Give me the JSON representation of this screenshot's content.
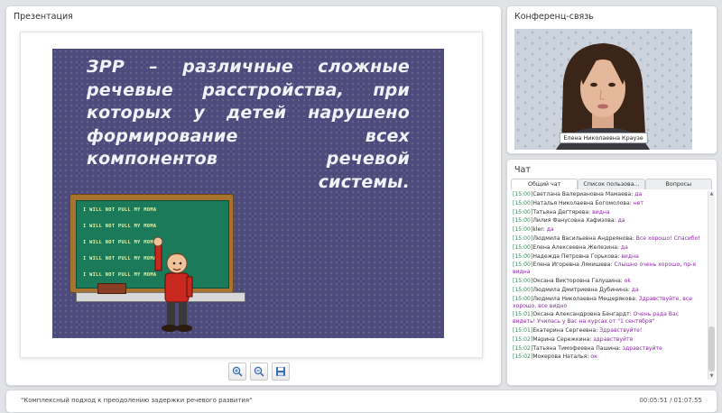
{
  "presentation": {
    "title": "Презентация",
    "slide": {
      "lines": [
        [
          "ЗРР",
          "–",
          "различные",
          "сложные"
        ],
        [
          "речевые",
          "расстройства,",
          "при"
        ],
        [
          "которых",
          "у",
          "детей",
          "нарушено"
        ],
        [
          "формирование",
          "всех"
        ],
        [
          "компонентов",
          "речевой"
        ]
      ],
      "last_line": "системы.",
      "board_lines": [
        "I WILL NOT PULL MY MOMA",
        "I WILL NOT PULL MY MOMA",
        "I WILL NOT PULL MY MOMA",
        "I WILL NOT PULL MY MOMA",
        "I WILL NOT PULL MY MOMA"
      ]
    },
    "toolbar": {
      "zoom_in": "zoom-in-icon",
      "zoom_out": "zoom-out-icon",
      "save": "save-icon"
    }
  },
  "conference": {
    "title": "Конференц-связь",
    "speaker_name": "Елена Николаевна Краузе"
  },
  "chat": {
    "title": "Чат",
    "tabs": [
      "Общий чат",
      "Список пользова...",
      "Вопросы"
    ],
    "active_tab": 0,
    "messages": [
      {
        "time": "[15:00]",
        "author": "Светлана Валериановна Мамаева:",
        "text": " да"
      },
      {
        "time": "[15:00]",
        "author": "Наталья Николаевна Богомолова:",
        "text": " нет"
      },
      {
        "time": "[15:00]",
        "author": "Татьяна Дегтярева:",
        "text": " видна"
      },
      {
        "time": "[15:00]",
        "author": "Лилия Фанусовна Хафизова:",
        "text": " да"
      },
      {
        "time": "[15:00]",
        "author": "kler:",
        "text": " да"
      },
      {
        "time": "[15:00]",
        "author": "Людмила Васильевна Андреянова:",
        "text": " Все хорошо! Спасибо!"
      },
      {
        "time": "[15:00]",
        "author": "Елена Алексеевна Железина:",
        "text": " да"
      },
      {
        "time": "[15:00]",
        "author": "Надежда Петровна Горькова:",
        "text": " видна"
      },
      {
        "time": "[15:00]",
        "author": "Елена Игоревна Лякишева:",
        "text": " Слышно очень хорошо, пр-я видна"
      },
      {
        "time": "[15:00]",
        "author": "Оксана Викторовна Галушина:",
        "text": " ok"
      },
      {
        "time": "[15:00]",
        "author": "Людмила Дмитриевна Дубинина:",
        "text": " да"
      },
      {
        "time": "[15:00]",
        "author": "Людмила Николаевна Мещерякова:",
        "text": " Здравствуйте, все хорошо, все видно"
      },
      {
        "time": "[15:01]",
        "author": "Оксана Александровна Бенгардт:",
        "text": " Очень рада Вас видеть! Училась у Вас на курсах от \"1 сентября\""
      },
      {
        "time": "[15:01]",
        "author": "Екатерина Сергеевна:",
        "text": " Здравствуйте!"
      },
      {
        "time": "[15:02]",
        "author": "Марина Сережкина:",
        "text": " здравствуйте"
      },
      {
        "time": "[15:02]",
        "author": "Татьяна Тимофеевна Пашина:",
        "text": " здравствуйте"
      },
      {
        "time": "[15:02]",
        "author": "Мокерова Наталья:",
        "text": " ок"
      }
    ]
  },
  "footer": {
    "title": "\"Комплексный подход к преодолению задержки речевого развития\"",
    "time": "00:05:51 / 01:07:55"
  },
  "colors": {
    "slide_bg": "#4d4b7c",
    "timestamp": "#2e8b57",
    "message_text": "#8e2aa9"
  }
}
